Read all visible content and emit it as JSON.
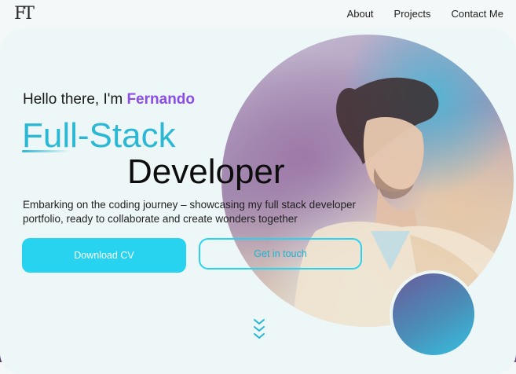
{
  "logo": {
    "text": "FT"
  },
  "nav": {
    "items": [
      {
        "label": "About"
      },
      {
        "label": "Projects"
      },
      {
        "label": "Contact Me"
      }
    ]
  },
  "hero": {
    "greeting_prefix": "Hello there, I'm ",
    "greeting_name": "Fernando",
    "title_line1": "Full-Stack",
    "title_line2": "Developer",
    "description": "Embarking on the coding journey – showcasing my full stack developer portfolio, ready to collaborate and create wonders together",
    "primary_button": "Download CV",
    "secondary_button": "Get in touch"
  },
  "colors": {
    "accent": "#27d3ee",
    "name_purple": "#8a4de8",
    "background": "#eef7f7"
  },
  "icons": {
    "scroll": "chevrons-down-icon",
    "portrait": "profile-portrait"
  }
}
